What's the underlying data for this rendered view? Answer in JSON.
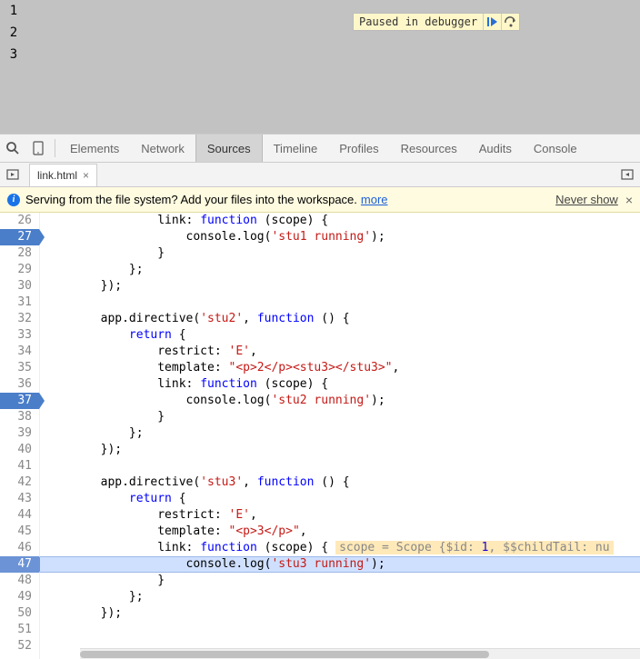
{
  "upper": {
    "lines": [
      "1",
      "2",
      "3"
    ]
  },
  "debugger": {
    "text": "Paused in debugger"
  },
  "tabs": {
    "elements": "Elements",
    "network": "Network",
    "sources": "Sources",
    "timeline": "Timeline",
    "profiles": "Profiles",
    "resources": "Resources",
    "audits": "Audits",
    "console": "Console"
  },
  "file": {
    "name": "link.html"
  },
  "infobar": {
    "text": "Serving from the file system? Add your files into the workspace.",
    "more": "more",
    "never": "Never show"
  },
  "lines": {
    "start": 26,
    "breakpoints": [
      27,
      37
    ],
    "exec": 47
  },
  "code": {
    "l26": {
      "pre": "                link: ",
      "kw": "function",
      "post": " (scope) {"
    },
    "l27": {
      "pre": "                    console.log(",
      "str": "'stu1 running'",
      "post": ");"
    },
    "l28": "                }",
    "l29": "            };",
    "l30": "        });",
    "l31": "",
    "l32": {
      "pre": "        app.directive(",
      "str": "'stu2'",
      "mid": ", ",
      "kw": "function",
      "post": " () {"
    },
    "l33": {
      "pre": "            ",
      "kw": "return",
      "post": " {"
    },
    "l34": {
      "pre": "                restrict: ",
      "str": "'E'",
      "post": ","
    },
    "l35": {
      "pre": "                template: ",
      "str": "\"<p>2</p><stu3></stu3>\"",
      "post": ","
    },
    "l36": {
      "pre": "                link: ",
      "kw": "function",
      "post": " (scope) {"
    },
    "l37": {
      "pre": "                    console.log(",
      "str": "'stu2 running'",
      "post": ");"
    },
    "l38": "                }",
    "l39": "            };",
    "l40": "        });",
    "l41": "",
    "l42": {
      "pre": "        app.directive(",
      "str": "'stu3'",
      "mid": ", ",
      "kw": "function",
      "post": " () {"
    },
    "l43": {
      "pre": "            ",
      "kw": "return",
      "post": " {"
    },
    "l44": {
      "pre": "                restrict: ",
      "str": "'E'",
      "post": ","
    },
    "l45": {
      "pre": "                template: ",
      "str": "\"<p>3</p>\"",
      "post": ","
    },
    "l46": {
      "pre": "                link: ",
      "kw": "function",
      "post": " (scope) {",
      "hint_pre": "scope = Scope {$id: ",
      "hint_num": "1",
      "hint_post": ", $$childTail: nu"
    },
    "l47": {
      "pre": "                    console.log(",
      "str": "'stu3 running'",
      "post": ");"
    },
    "l48": "                }",
    "l49": "            };",
    "l50": "        });",
    "l51": "",
    "l52": ""
  }
}
